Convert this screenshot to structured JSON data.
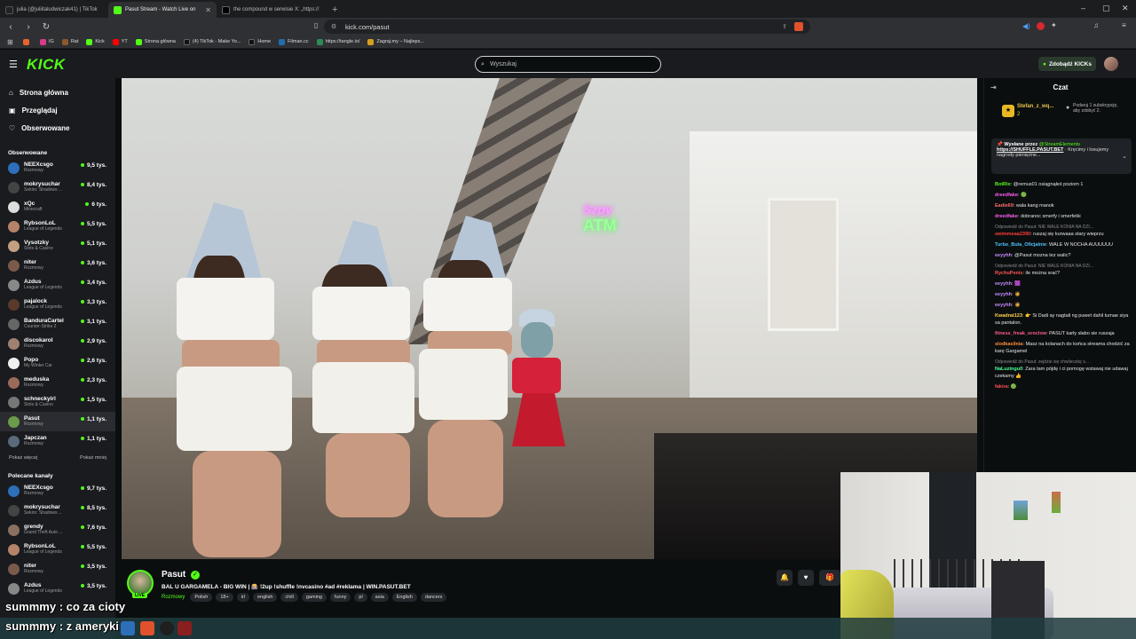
{
  "browser": {
    "tabs": [
      {
        "label": "julia (@juliitaludwiczak41) | TikTok",
        "color": "#222222"
      },
      {
        "label": "Pasut Stream - Watch Live on",
        "color": "#53fc18"
      },
      {
        "label": "the compound w serwisie X: „https://",
        "color": "#444444"
      }
    ],
    "new_tab": "+",
    "url": "kick.com/pasut",
    "bookmarks": [
      {
        "label": "",
        "color": "#e8632b"
      },
      {
        "label": "IG",
        "color": "#d63b8c"
      },
      {
        "label": "Rat",
        "color": "#8a5a2b"
      },
      {
        "label": "Kick",
        "color": "#53fc18"
      },
      {
        "label": "YT",
        "color": "#ff0000"
      },
      {
        "label": "Strona główna",
        "color": "#53fc18"
      },
      {
        "label": "(4) TikTok - Make Yo...",
        "color": "#111111"
      },
      {
        "label": "Home",
        "color": "#111111"
      },
      {
        "label": "Filman.cc",
        "color": "#1f6fb0"
      },
      {
        "label": "https://tangle.io/",
        "color": "#2e8b57"
      },
      {
        "label": "Zagraj.my – Najleps...",
        "color": "#d4a020"
      }
    ]
  },
  "kick": {
    "logo": "KICK",
    "search_placeholder": "Wyszukaj",
    "get_kicks": "Zdobądź KICKs"
  },
  "sidebar": {
    "nav": [
      {
        "label": "Strona główna",
        "icon": "home-icon",
        "glyph": "⌂"
      },
      {
        "label": "Przeglądaj",
        "icon": "browse-icon",
        "glyph": "▣"
      },
      {
        "label": "Obserwowane",
        "icon": "heart-icon",
        "glyph": "♡"
      }
    ],
    "followed_title": "Obserwowane",
    "followed": [
      {
        "name": "NEEXcsgo",
        "category": "Rozmowy",
        "viewers": "9,5 tys.",
        "color": "#2d6fb8"
      },
      {
        "name": "mokrysuchar",
        "category": "Sekiro: Shadows ...",
        "viewers": "8,4 tys.",
        "color": "#444444"
      },
      {
        "name": "xQc",
        "category": "Minecraft",
        "viewers": "6 tys.",
        "color": "#dddddd"
      },
      {
        "name": "RybsonLoL",
        "category": "League of Legends",
        "viewers": "5,5 tys.",
        "color": "#b5836a"
      },
      {
        "name": "Vysotzky",
        "category": "Slots & Casino",
        "viewers": "5,1 tys.",
        "color": "#c2a080"
      },
      {
        "name": "niter",
        "category": "Rozmowy",
        "viewers": "3,6 tys.",
        "color": "#7a5a4a"
      },
      {
        "name": "Azdus",
        "category": "League of Legends",
        "viewers": "3,4 tys.",
        "color": "#888888"
      },
      {
        "name": "pajalock",
        "category": "League of Legends",
        "viewers": "3,3 tys.",
        "color": "#5a3a2a"
      },
      {
        "name": "BanduraCartel",
        "category": "Counter-Strike 2",
        "viewers": "3,1 tys.",
        "color": "#666666"
      },
      {
        "name": "discokarol",
        "category": "Rozmowy",
        "viewers": "2,9 tys.",
        "color": "#a08070"
      },
      {
        "name": "Popo",
        "category": "My Winter Car",
        "viewers": "2,6 tys.",
        "color": "#f0f0f0"
      },
      {
        "name": "meduska",
        "category": "Rozmowy",
        "viewers": "2,3 tys.",
        "color": "#9a6a5a"
      },
      {
        "name": "schneckyirl",
        "category": "Slots & Casino",
        "viewers": "1,5 tys.",
        "color": "#777777"
      },
      {
        "name": "Pasut",
        "category": "Rozmowy",
        "viewers": "1,1 tys.",
        "color": "#6b9a4a"
      },
      {
        "name": "Japczan",
        "category": "Rozmowy",
        "viewers": "1,1 tys.",
        "color": "#5a6a7a"
      }
    ],
    "show_more": "Pokaż więcej",
    "show_less": "Pokaż mniej",
    "recommended_title": "Polecane kanały",
    "recommended": [
      {
        "name": "NEEXcsgo",
        "category": "Rozmowy",
        "viewers": "9,7 tys.",
        "color": "#2d6fb8"
      },
      {
        "name": "mokrysuchar",
        "category": "Sekiro: Shadows ...",
        "viewers": "8,5 tys.",
        "color": "#444444"
      },
      {
        "name": "grendy",
        "category": "Grand Theft Auto ...",
        "viewers": "7,6 tys.",
        "color": "#8a7060"
      },
      {
        "name": "RybsonLoL",
        "category": "League of Legends",
        "viewers": "5,5 tys.",
        "color": "#b5836a"
      },
      {
        "name": "niter",
        "category": "Rozmowy",
        "viewers": "3,5 tys.",
        "color": "#7a5a4a"
      },
      {
        "name": "Azdus",
        "category": "League of Legends",
        "viewers": "3,5 tys.",
        "color": "#888888"
      }
    ]
  },
  "video": {
    "neon_line1": "Szpy",
    "neon_line2": "ATM"
  },
  "stream": {
    "channel": "Pasut",
    "live": "LIVE",
    "title": "BAL U GARGAMELA - BIG WIN | 🎰 !2up !shuffle !nvcasino #ad #reklama | WIN.PASUT.BET",
    "category": "Rozmowy",
    "tags": [
      "Polish",
      "18+",
      "irl",
      "english",
      "chill",
      "gaming",
      "funny",
      "pl",
      "asia",
      "English",
      "dancers"
    ]
  },
  "chat": {
    "title": "Czat",
    "gifter_name": "Stefan_z_wq...",
    "gifter_count": "2",
    "gift_note": "Podaruj 1 subskrypcję, aby zdobyć 2.",
    "pinned_by": "Wysłane przez",
    "pinned_author": "@StreamElements",
    "pinned_link": "https://SHUFFLE.PASUT.BET",
    "pinned_text": "· Kręcimy i losujemy nagrody pieniężne...",
    "messages": [
      {
        "user": "BotRix",
        "color": "#53fc18",
        "text": "@remus01 osiągnąłeś poziom 1",
        "reply": ""
      },
      {
        "user": "dreedfake",
        "color": "#ff5cf0",
        "text": "🟢",
        "reply": ""
      },
      {
        "user": "Eadie69",
        "color": "#ff6b6b",
        "text": "wala kang manok",
        "reply": ""
      },
      {
        "user": "dreedfake",
        "color": "#ff5cf0",
        "text": "dobranoc smerfy i smerfetki",
        "reply": ""
      },
      {
        "user": "swimmeaa2390",
        "color": "#ff3b3b",
        "text": "ruszaj się kurwaaa stary wieprzu",
        "reply": "Odpowiedź do Pasut: NIE WALE KONIA NA DZI..."
      },
      {
        "user": "Turbo_Bula_Oficjalnie",
        "color": "#4fc3ff",
        "text": "WALE W NOCHA AUUUUUU",
        "reply": ""
      },
      {
        "user": "eeyyhh",
        "color": "#c58cff",
        "text": "@Pasut mozna tez walic?",
        "reply": ""
      },
      {
        "user": "RychuPenis",
        "color": "#ff5555",
        "text": "ile można srać?",
        "reply": "Odpowiedź do Pasut: NIE WALE KONIA NA DZI..."
      },
      {
        "user": "eeyyhh",
        "color": "#c58cff",
        "text": "🟪",
        "reply": ""
      },
      {
        "user": "eeyyhh",
        "color": "#c58cff",
        "text": "🧔",
        "reply": ""
      },
      {
        "user": "eeyyhh",
        "color": "#c58cff",
        "text": "🧔",
        "reply": ""
      },
      {
        "user": "Kwadrat123",
        "color": "#ffd34f",
        "text": "👉 Si Dadi ay nagtali ng puwet dahil tumae siya sa pantalon.",
        "reply": ""
      },
      {
        "user": "fitness_freak_oroclow",
        "color": "#ff5c8a",
        "text": "PASUT karły słabo sie ruszaja",
        "reply": ""
      },
      {
        "user": "slodkasilnia",
        "color": "#ff8c3b",
        "text": "Masz na kolanach do końca streama chodzić za karę Gargamel",
        "reply": ""
      },
      {
        "user": "NaLuzingu0",
        "color": "#4fff9a",
        "text": "Zara tam pójdę i ci pomogę wstawaj nie udawaj czekamy 👍",
        "reply": "Odpowiedź do Pasut: zejdzie się chwileczkę s..."
      },
      {
        "user": "fakira",
        "color": "#ff4f4f",
        "text": "🟢",
        "reply": ""
      }
    ]
  },
  "overlay": {
    "caption1": "summmy : co za cioty",
    "caption2": "summmy : z ameryki"
  }
}
